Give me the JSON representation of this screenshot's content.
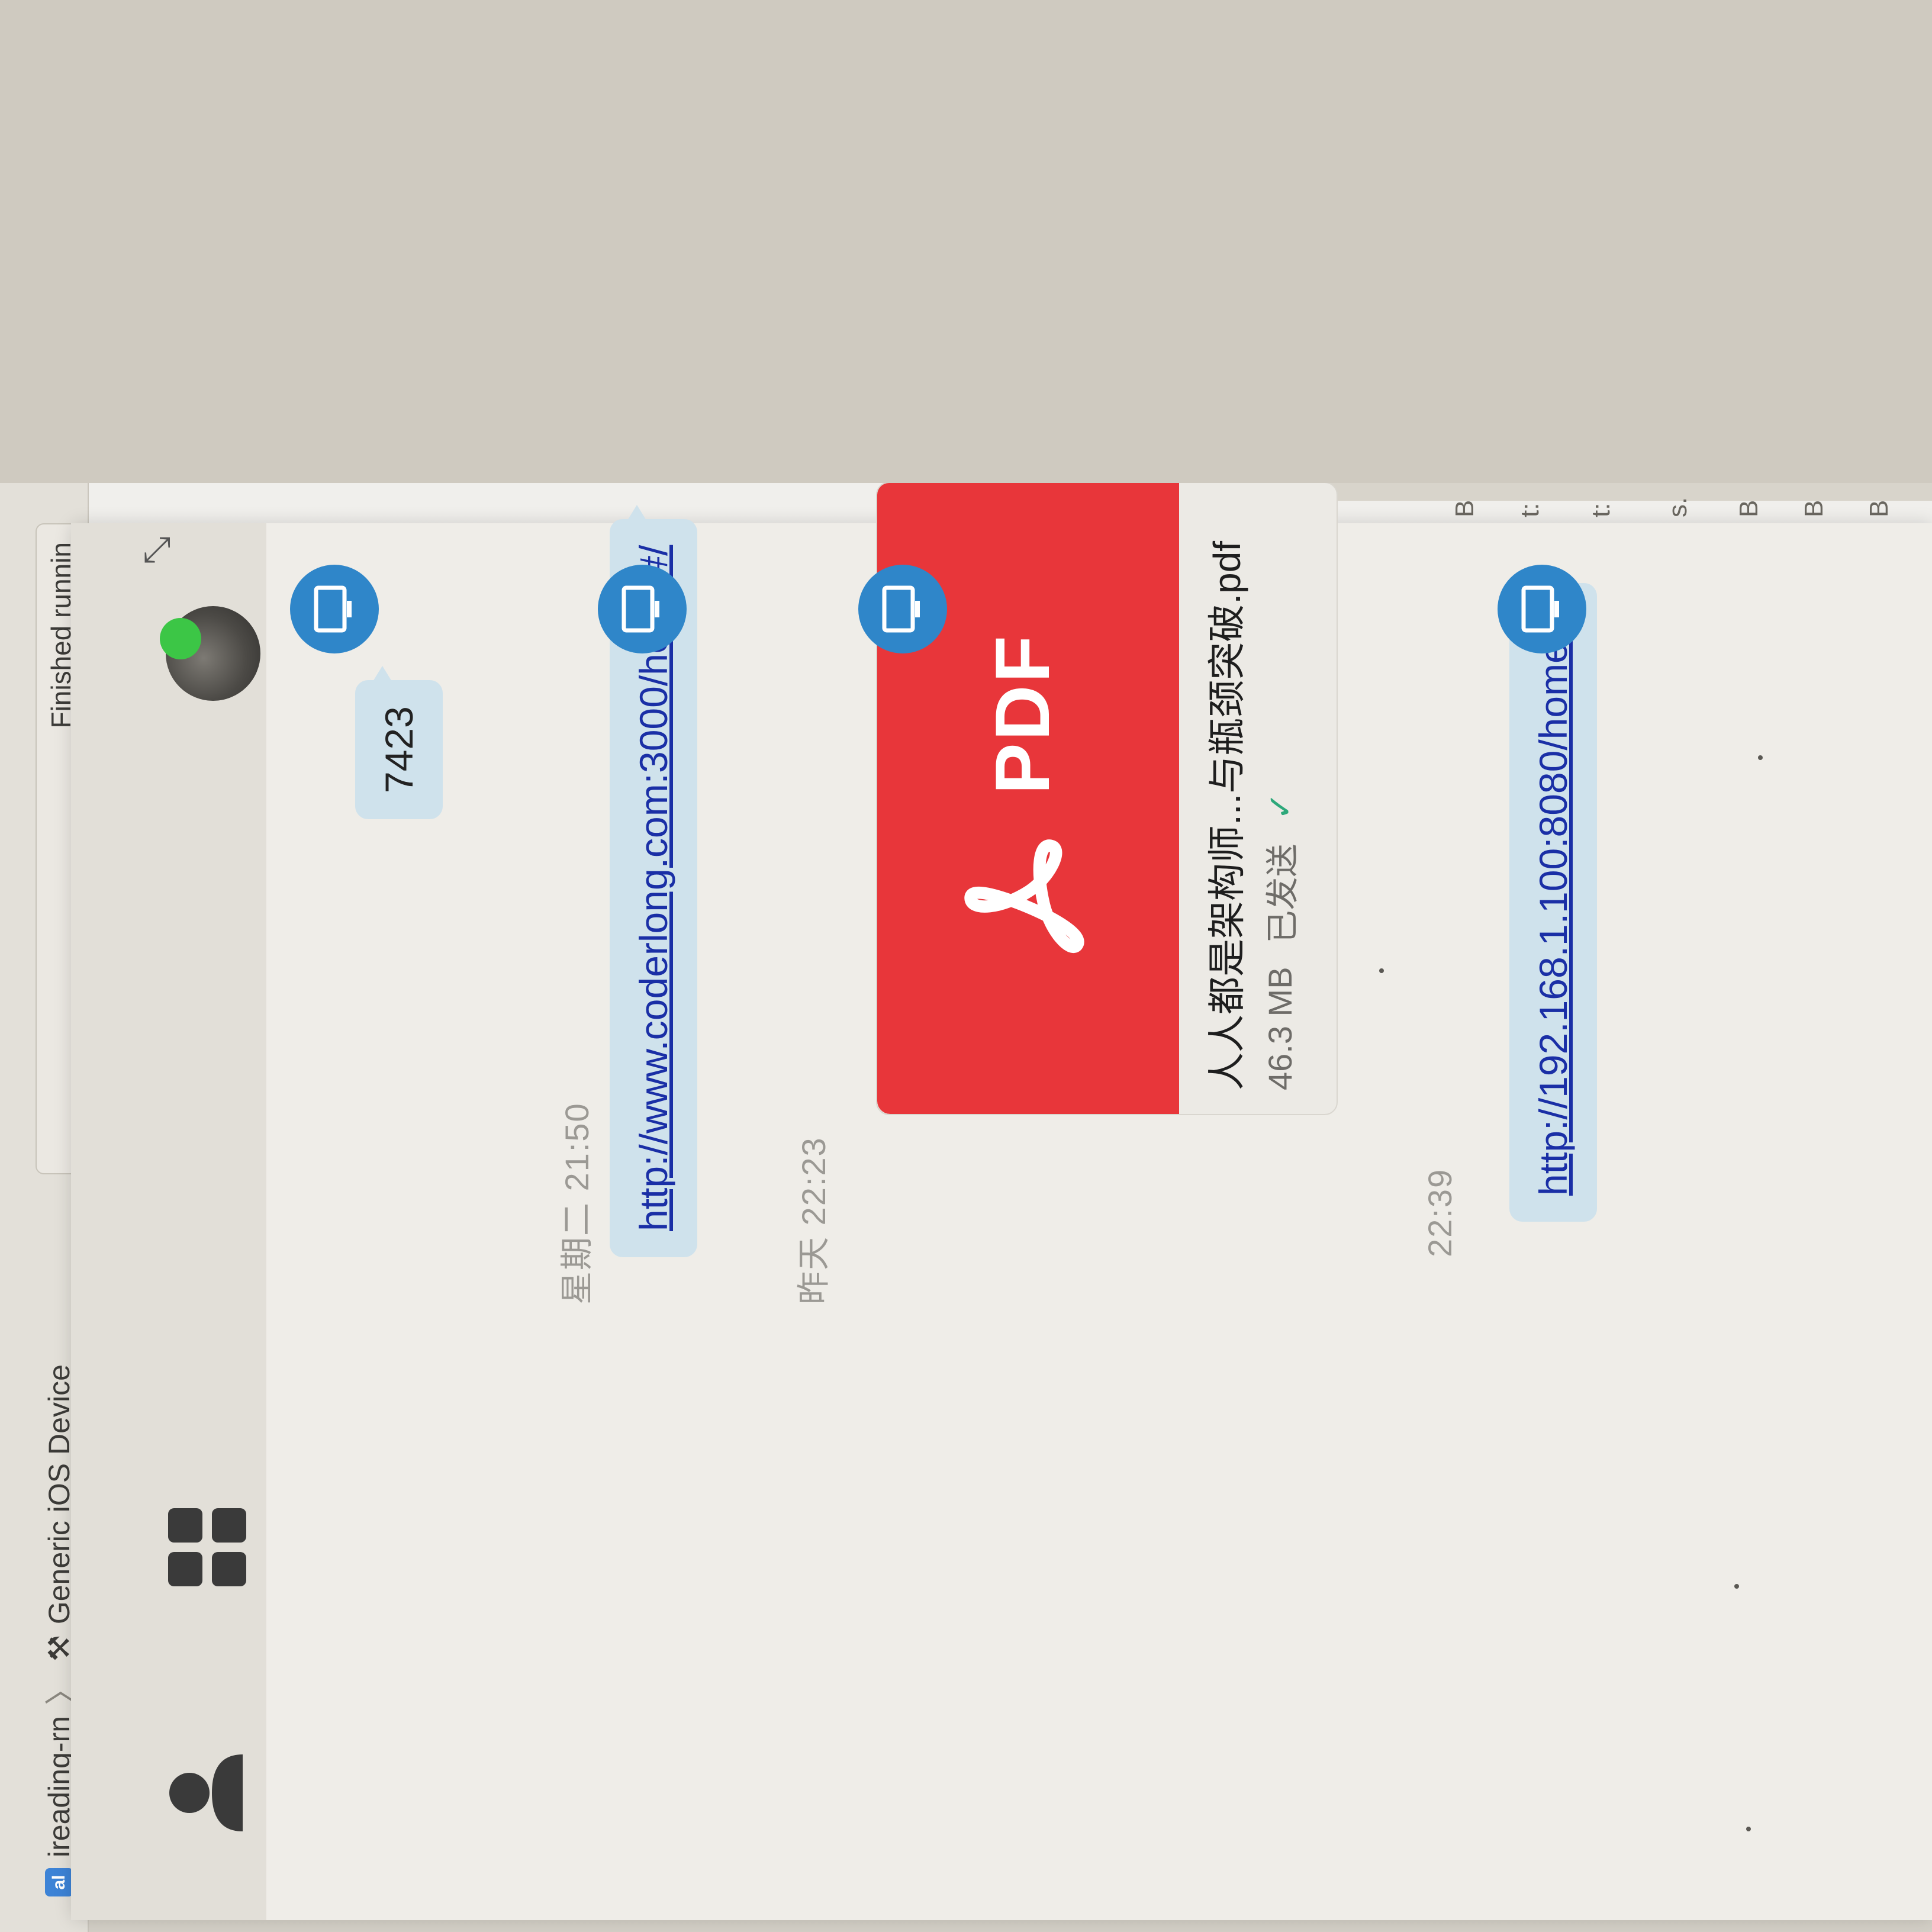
{
  "xcode": {
    "app_badge": "al",
    "scheme_name": "ireading-rn",
    "device_name": "Generic iOS Device",
    "status_text": "Finished runnin",
    "edge_fragments": [
      "B",
      "t:",
      "t:",
      "s.",
      "B",
      "B",
      "B"
    ]
  },
  "chat": {
    "messages": [
      {
        "type": "text",
        "text": "7423"
      },
      {
        "type": "timestamp",
        "text": "星期二 21:50"
      },
      {
        "type": "link",
        "text": "http://www.coderlong.com:3000/home#/"
      },
      {
        "type": "timestamp",
        "text": "昨天 22:23"
      },
      {
        "type": "file",
        "icon_label": "PDF",
        "file_name": "人人都是架构师...与瓶颈突破.pdf",
        "file_size": "46.3 MB",
        "status": "已发送"
      },
      {
        "type": "timestamp",
        "text": "22:39"
      },
      {
        "type": "link",
        "text": "http://192.168.1.100:8080/home#/"
      }
    ]
  },
  "icons": {
    "contact": "contact-icon",
    "apps": "grid-icon",
    "avatar": "avatar",
    "online": "online-status-icon",
    "sender": "computer-icon",
    "collapse": "collapse-icon",
    "pdf": "pdf-icon",
    "sent": "check-icon"
  },
  "colors": {
    "bubble": "#cfe2ec",
    "link": "#1a2fa6",
    "pdf_red": "#e8363a",
    "sender_avatar": "#2f86c9",
    "online": "#3cc646",
    "sent_check": "#2da87a"
  }
}
